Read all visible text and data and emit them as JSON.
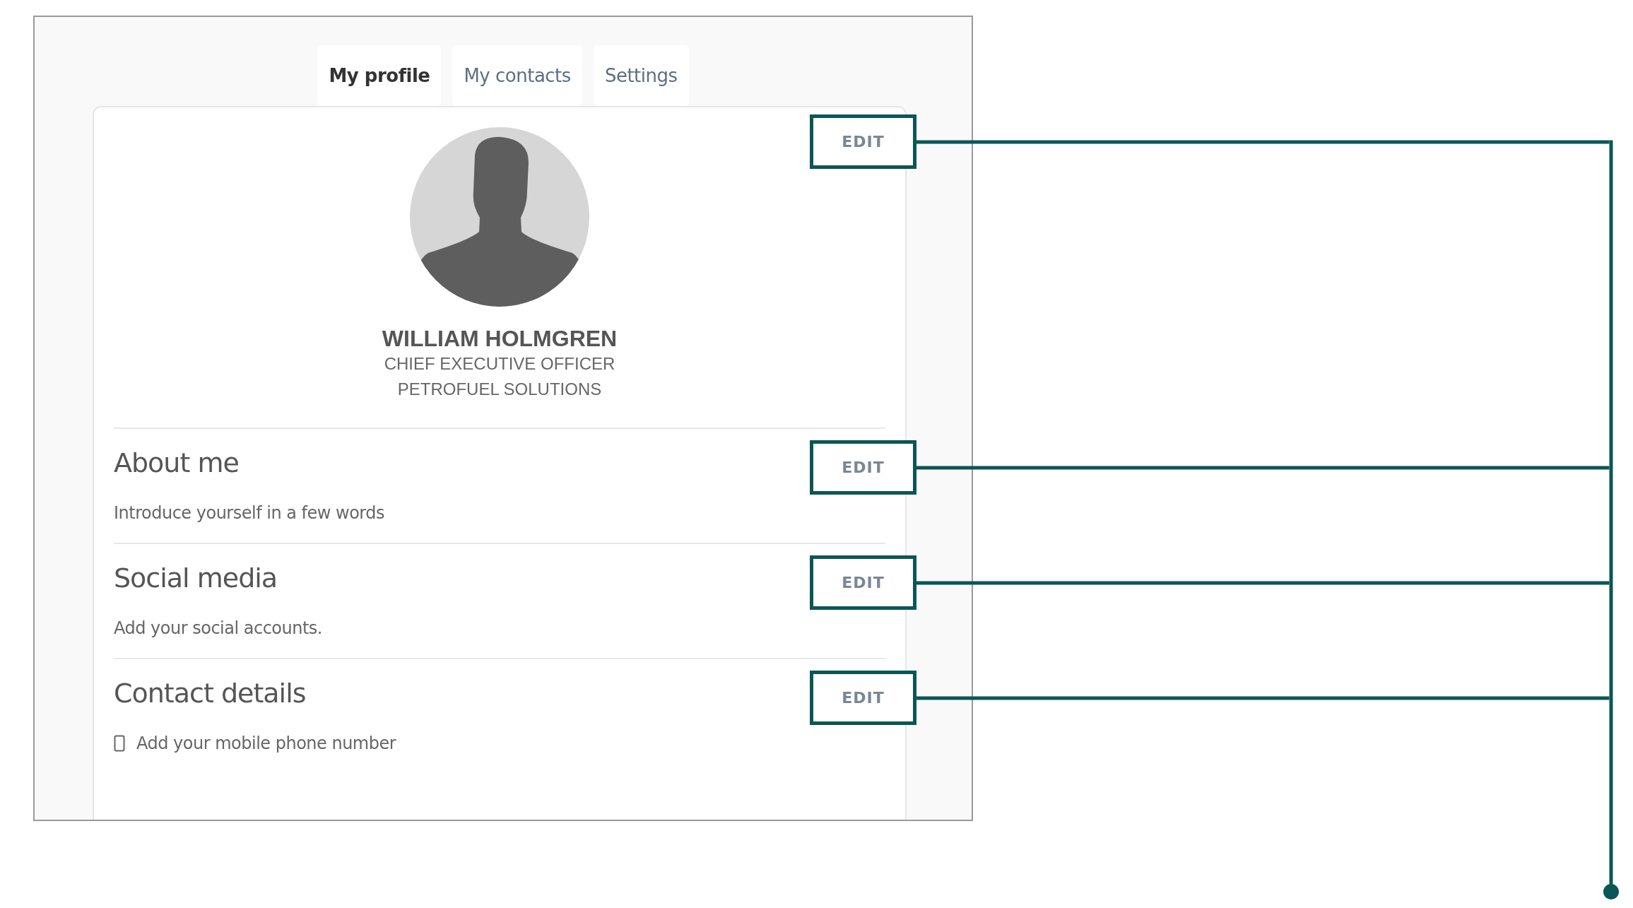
{
  "tabs": [
    {
      "label": "My profile",
      "selected": true
    },
    {
      "label": "My contacts",
      "selected": false
    },
    {
      "label": "Settings",
      "selected": false
    }
  ],
  "profile": {
    "name": "WILLIAM HOLMGREN",
    "title": "CHIEF EXECUTIVE OFFICER",
    "company": "PETROFUEL SOLUTIONS",
    "edit_button": "EDIT"
  },
  "sections": [
    {
      "heading": "About me",
      "edit_button": "EDIT",
      "items": [
        {
          "kind": "text",
          "text": "Introduce yourself in a few words"
        }
      ]
    },
    {
      "heading": "Social media",
      "edit_button": "EDIT",
      "items": [
        {
          "kind": "text",
          "text": "Add your social accounts."
        }
      ]
    },
    {
      "heading": "Contact details",
      "edit_button": "EDIT",
      "items": [
        {
          "kind": "phone",
          "text": "Add your mobile phone number"
        }
      ]
    }
  ]
}
